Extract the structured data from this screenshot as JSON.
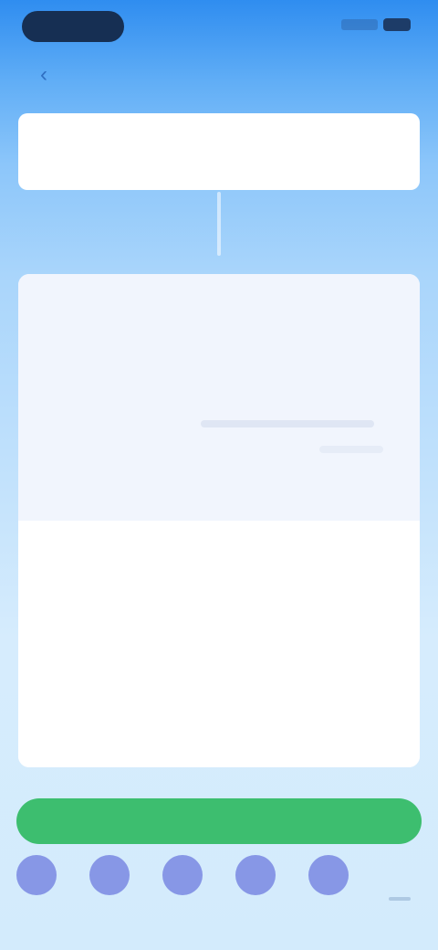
{
  "status_bar": {
    "time": "",
    "icons": [
      "signal-icon",
      "battery-icon"
    ]
  },
  "nav": {
    "back_icon": "‹"
  },
  "title_card": {
    "label": "",
    "value": ""
  },
  "panel": {
    "heading": "",
    "subheading": "",
    "row_left": "",
    "row_right": "",
    "footer_text": ""
  },
  "primary_action": {
    "label": ""
  },
  "bottom_bar": {
    "icons": [
      "app-icon-1",
      "app-icon-2",
      "app-icon-3",
      "app-icon-4",
      "app-icon-5"
    ]
  },
  "colors": {
    "accent_blue": "#2f8df0",
    "button_green": "#3dbe6f",
    "icon_purple": "#8797e6"
  }
}
